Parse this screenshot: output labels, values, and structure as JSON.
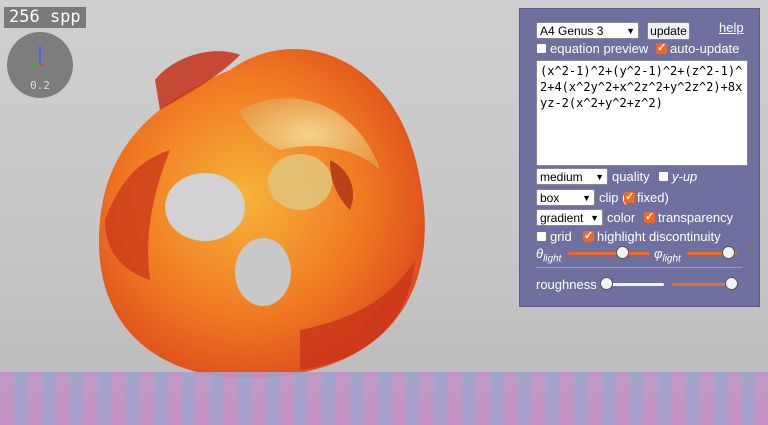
{
  "overlay": {
    "spp_label": "256 spp",
    "gizmo_scale": "0.2"
  },
  "controls": {
    "surface_select": "A4 Genus 3",
    "update_label": "update",
    "help_label": "help",
    "equation_preview": {
      "label": "equation preview",
      "checked": false
    },
    "auto_update": {
      "label": "auto-update",
      "checked": true
    },
    "equation": "(x^2-1)^2+(y^2-1)^2+(z^2-1)^2+4(x^2y^2+x^2z^2+y^2z^2)+8xyz-2(x^2+y^2+z^2)",
    "quality_select": "medium",
    "quality_label": "quality",
    "y_up": {
      "label": "y-up",
      "checked": false
    },
    "clip_select": "box",
    "clip_label": "clip (",
    "clip_fixed": {
      "label": "fixed)",
      "checked": true
    },
    "color_select": "gradient",
    "color_label": "color",
    "transparency": {
      "label": "transparency",
      "checked": true
    },
    "grid": {
      "label": "grid",
      "checked": false
    },
    "highlight_discontinuity": {
      "label": "highlight discontinuity",
      "checked": true
    },
    "theta_light": {
      "symbol": "θ",
      "sub": "light",
      "value": 0.7
    },
    "phi_light": {
      "symbol": "φ",
      "sub": "light",
      "value": 0.95
    },
    "roughness": {
      "label": "roughness",
      "value": 0.0
    },
    "roughness2": {
      "value": 1.0
    }
  },
  "colors": {
    "accent": "#f06a23",
    "panel": "#6f6fa0"
  }
}
